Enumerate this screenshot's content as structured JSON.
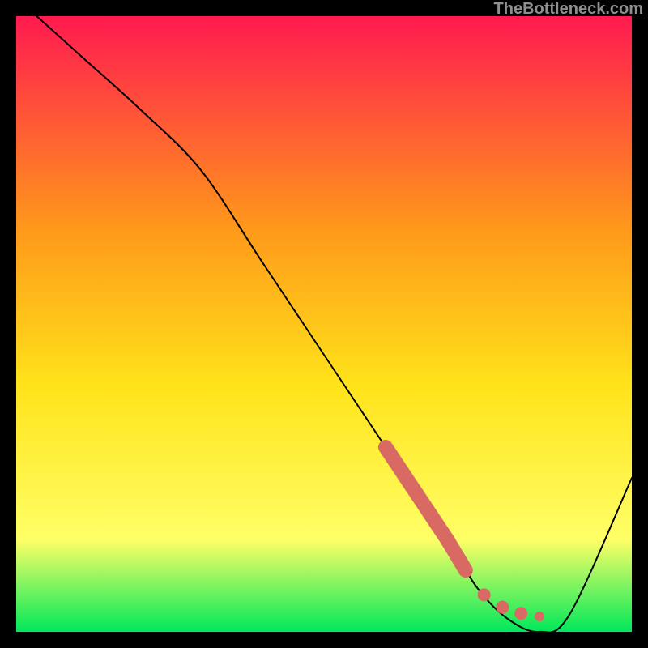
{
  "watermark": "TheBottleneck.com",
  "chart_data": {
    "type": "line",
    "title": "",
    "xlabel": "",
    "ylabel": "",
    "xlim": [
      0,
      100
    ],
    "ylim": [
      0,
      100
    ],
    "series": [
      {
        "name": "bottleneck-curve",
        "x": [
          0,
          10,
          20,
          30,
          40,
          50,
          60,
          70,
          75,
          80,
          85,
          90,
          100
        ],
        "y": [
          103,
          94,
          85,
          75,
          60,
          45,
          30,
          15,
          7,
          2,
          0,
          3,
          25
        ]
      }
    ],
    "highlight_segment": {
      "name": "optimal-range-marker",
      "x": [
        60,
        62,
        64,
        66,
        68,
        70,
        73,
        76,
        79,
        82,
        85
      ],
      "y": [
        30,
        27,
        24,
        21,
        18,
        15,
        10,
        6,
        4,
        3,
        2.5
      ]
    },
    "gradient": {
      "top_color": "#ff1a50",
      "mid1_color": "#ff9a1a",
      "mid2_color": "#ffe31a",
      "mid3_color": "#ffff66",
      "bottom_color": "#00e85b"
    }
  }
}
